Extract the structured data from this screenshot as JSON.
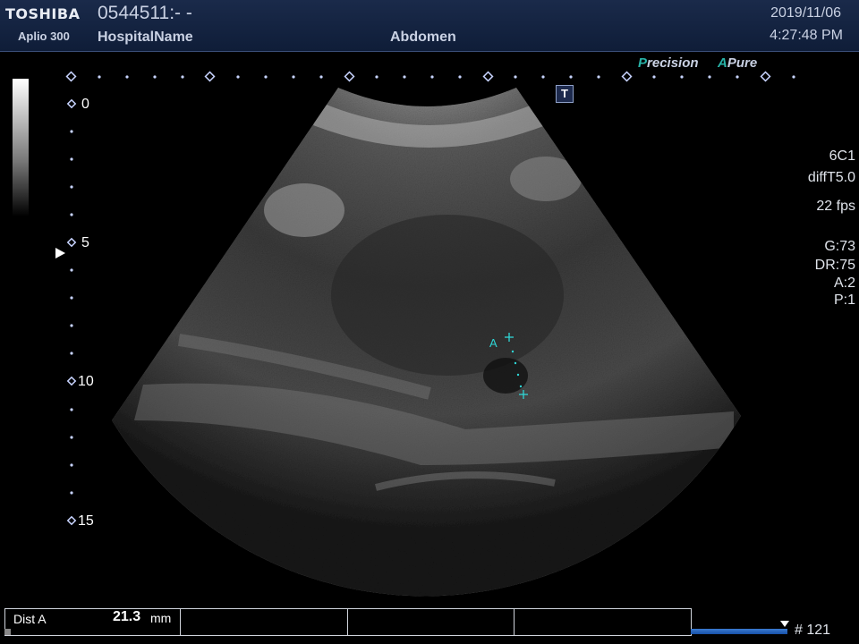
{
  "header": {
    "brand": "TOSHIBA",
    "model": "Aplio 300",
    "patient_id": "0544511:- -",
    "hospital": "HospitalName",
    "exam": "Abdomen",
    "date": "2019/11/06",
    "time": "4:27:48 PM"
  },
  "badges": {
    "precision_first": "P",
    "precision_rest": "recision",
    "apure_first": "A",
    "apure_rest": "Pure",
    "t_mark": "T",
    "accent_color": "#28b3a8"
  },
  "depth_scale": {
    "labels": [
      "0",
      "5",
      "10",
      "15"
    ]
  },
  "parameters": {
    "probe": "6C1",
    "mode": "diffT5.0",
    "frame_rate": "22 fps",
    "gain": "G:73",
    "dynamic_range": "DR:75",
    "a": "A:2",
    "p": "P:1"
  },
  "caliper": {
    "label": "A",
    "color": "#2fd6d6"
  },
  "measurement": {
    "name": "Dist A",
    "value": "21.3",
    "unit": "mm"
  },
  "cine": {
    "frame_label": "# 121"
  }
}
